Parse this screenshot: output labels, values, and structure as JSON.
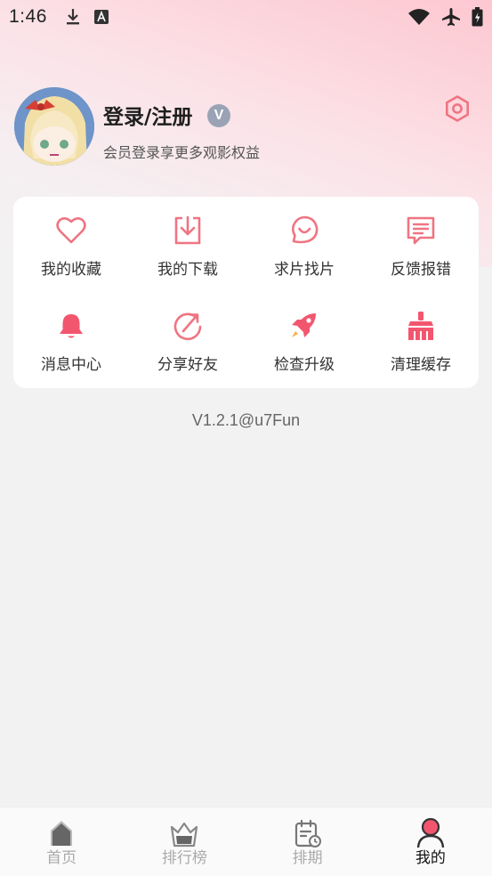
{
  "status_bar": {
    "time": "1:46",
    "left_icons": [
      "download-icon",
      "a-icon"
    ],
    "right_icons": [
      "wifi-icon",
      "airplane-icon",
      "battery-icon"
    ]
  },
  "profile": {
    "username": "登录/注册",
    "badge": "V",
    "subtitle": "会员登录享更多观影权益"
  },
  "menu": [
    {
      "label": "我的收藏",
      "icon": "heart-icon"
    },
    {
      "label": "我的下载",
      "icon": "download-tray-icon"
    },
    {
      "label": "求片找片",
      "icon": "chat-smile-icon"
    },
    {
      "label": "反馈报错",
      "icon": "feedback-icon"
    },
    {
      "label": "消息中心",
      "icon": "bell-icon"
    },
    {
      "label": "分享好友",
      "icon": "share-icon"
    },
    {
      "label": "检查升级",
      "icon": "rocket-icon"
    },
    {
      "label": "清理缓存",
      "icon": "broom-icon"
    }
  ],
  "version": "V1.2.1@u7Fun",
  "bottom_nav": [
    {
      "label": "首页",
      "icon": "home-icon",
      "active": false
    },
    {
      "label": "排行榜",
      "icon": "crown-icon",
      "active": false
    },
    {
      "label": "排期",
      "icon": "calendar-icon",
      "active": false
    },
    {
      "label": "我的",
      "icon": "user-icon",
      "active": true
    }
  ],
  "colors": {
    "accent": "#f2566f",
    "accent_light": "#f07482",
    "header_pink": "#fdc7d0",
    "badge_gray": "#9aa3b5"
  }
}
